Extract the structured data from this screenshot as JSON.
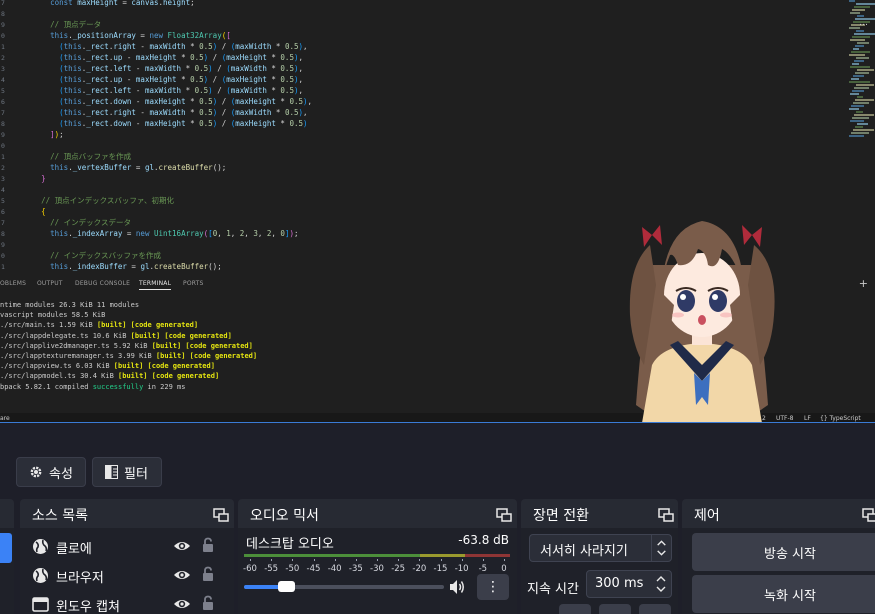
{
  "editor": {
    "line_numbers": [
      "7",
      "8",
      "9",
      "0",
      "1",
      "2",
      "3",
      "4",
      "5",
      "6",
      "7",
      "8",
      "9",
      "0",
      "1",
      "2",
      "3",
      "4",
      "5",
      "6",
      "7",
      "8",
      "9",
      "0",
      "1"
    ],
    "code": [
      [
        {
          "t": "        ",
          "c": "punc"
        },
        {
          "t": "const",
          "c": "kw"
        },
        {
          "t": " maxHeight",
          "c": "ident"
        },
        {
          "t": " = ",
          "c": "punc"
        },
        {
          "t": "canvas",
          "c": "ident"
        },
        {
          "t": ".",
          "c": "punc"
        },
        {
          "t": "height",
          "c": "ident"
        },
        {
          "t": ";",
          "c": "punc"
        }
      ],
      [],
      [
        {
          "t": "        ",
          "c": "punc"
        },
        {
          "t": "// 頂点データ",
          "c": "cm"
        }
      ],
      [
        {
          "t": "        ",
          "c": "punc"
        },
        {
          "t": "this",
          "c": "kw"
        },
        {
          "t": ".",
          "c": "punc"
        },
        {
          "t": "_positionArray",
          "c": "ident"
        },
        {
          "t": " = ",
          "c": "punc"
        },
        {
          "t": "new",
          "c": "kw"
        },
        {
          "t": " ",
          "c": "punc"
        },
        {
          "t": "Float32Array",
          "c": "cls"
        },
        {
          "t": "(",
          "c": "br1"
        },
        {
          "t": "[",
          "c": "br2"
        }
      ],
      [
        {
          "t": "          (",
          "c": "br3"
        },
        {
          "t": "this",
          "c": "kw"
        },
        {
          "t": ".",
          "c": "punc"
        },
        {
          "t": "_rect",
          "c": "ident"
        },
        {
          "t": ".",
          "c": "punc"
        },
        {
          "t": "right",
          "c": "ident"
        },
        {
          "t": " - ",
          "c": "punc"
        },
        {
          "t": "maxWidth",
          "c": "ident"
        },
        {
          "t": " * ",
          "c": "punc"
        },
        {
          "t": "0.5",
          "c": "num"
        },
        {
          "t": ")",
          "c": "br3"
        },
        {
          "t": " / ",
          "c": "punc"
        },
        {
          "t": "(",
          "c": "br3"
        },
        {
          "t": "maxWidth",
          "c": "ident"
        },
        {
          "t": " * ",
          "c": "punc"
        },
        {
          "t": "0.5",
          "c": "num"
        },
        {
          "t": ")",
          "c": "br3"
        },
        {
          "t": ",",
          "c": "punc"
        }
      ],
      [
        {
          "t": "          (",
          "c": "br3"
        },
        {
          "t": "this",
          "c": "kw"
        },
        {
          "t": ".",
          "c": "punc"
        },
        {
          "t": "_rect",
          "c": "ident"
        },
        {
          "t": ".",
          "c": "punc"
        },
        {
          "t": "up",
          "c": "ident"
        },
        {
          "t": " - ",
          "c": "punc"
        },
        {
          "t": "maxHeight",
          "c": "ident"
        },
        {
          "t": " * ",
          "c": "punc"
        },
        {
          "t": "0.5",
          "c": "num"
        },
        {
          "t": ")",
          "c": "br3"
        },
        {
          "t": " / ",
          "c": "punc"
        },
        {
          "t": "(",
          "c": "br3"
        },
        {
          "t": "maxHeight",
          "c": "ident"
        },
        {
          "t": " * ",
          "c": "punc"
        },
        {
          "t": "0.5",
          "c": "num"
        },
        {
          "t": ")",
          "c": "br3"
        },
        {
          "t": ",",
          "c": "punc"
        }
      ],
      [
        {
          "t": "          (",
          "c": "br3"
        },
        {
          "t": "this",
          "c": "kw"
        },
        {
          "t": ".",
          "c": "punc"
        },
        {
          "t": "_rect",
          "c": "ident"
        },
        {
          "t": ".",
          "c": "punc"
        },
        {
          "t": "left",
          "c": "ident"
        },
        {
          "t": " - ",
          "c": "punc"
        },
        {
          "t": "maxWidth",
          "c": "ident"
        },
        {
          "t": " * ",
          "c": "punc"
        },
        {
          "t": "0.5",
          "c": "num"
        },
        {
          "t": ")",
          "c": "br3"
        },
        {
          "t": " / ",
          "c": "punc"
        },
        {
          "t": "(",
          "c": "br3"
        },
        {
          "t": "maxWidth",
          "c": "ident"
        },
        {
          "t": " * ",
          "c": "punc"
        },
        {
          "t": "0.5",
          "c": "num"
        },
        {
          "t": ")",
          "c": "br3"
        },
        {
          "t": ",",
          "c": "punc"
        }
      ],
      [
        {
          "t": "          (",
          "c": "br3"
        },
        {
          "t": "this",
          "c": "kw"
        },
        {
          "t": ".",
          "c": "punc"
        },
        {
          "t": "_rect",
          "c": "ident"
        },
        {
          "t": ".",
          "c": "punc"
        },
        {
          "t": "up",
          "c": "ident"
        },
        {
          "t": " - ",
          "c": "punc"
        },
        {
          "t": "maxHeight",
          "c": "ident"
        },
        {
          "t": " * ",
          "c": "punc"
        },
        {
          "t": "0.5",
          "c": "num"
        },
        {
          "t": ")",
          "c": "br3"
        },
        {
          "t": " / ",
          "c": "punc"
        },
        {
          "t": "(",
          "c": "br3"
        },
        {
          "t": "maxHeight",
          "c": "ident"
        },
        {
          "t": " * ",
          "c": "punc"
        },
        {
          "t": "0.5",
          "c": "num"
        },
        {
          "t": ")",
          "c": "br3"
        },
        {
          "t": ",",
          "c": "punc"
        }
      ],
      [
        {
          "t": "          (",
          "c": "br3"
        },
        {
          "t": "this",
          "c": "kw"
        },
        {
          "t": ".",
          "c": "punc"
        },
        {
          "t": "_rect",
          "c": "ident"
        },
        {
          "t": ".",
          "c": "punc"
        },
        {
          "t": "left",
          "c": "ident"
        },
        {
          "t": " - ",
          "c": "punc"
        },
        {
          "t": "maxWidth",
          "c": "ident"
        },
        {
          "t": " * ",
          "c": "punc"
        },
        {
          "t": "0.5",
          "c": "num"
        },
        {
          "t": ")",
          "c": "br3"
        },
        {
          "t": " / ",
          "c": "punc"
        },
        {
          "t": "(",
          "c": "br3"
        },
        {
          "t": "maxWidth",
          "c": "ident"
        },
        {
          "t": " * ",
          "c": "punc"
        },
        {
          "t": "0.5",
          "c": "num"
        },
        {
          "t": ")",
          "c": "br3"
        },
        {
          "t": ",",
          "c": "punc"
        }
      ],
      [
        {
          "t": "          (",
          "c": "br3"
        },
        {
          "t": "this",
          "c": "kw"
        },
        {
          "t": ".",
          "c": "punc"
        },
        {
          "t": "_rect",
          "c": "ident"
        },
        {
          "t": ".",
          "c": "punc"
        },
        {
          "t": "down",
          "c": "ident"
        },
        {
          "t": " - ",
          "c": "punc"
        },
        {
          "t": "maxHeight",
          "c": "ident"
        },
        {
          "t": " * ",
          "c": "punc"
        },
        {
          "t": "0.5",
          "c": "num"
        },
        {
          "t": ")",
          "c": "br3"
        },
        {
          "t": " / ",
          "c": "punc"
        },
        {
          "t": "(",
          "c": "br3"
        },
        {
          "t": "maxHeight",
          "c": "ident"
        },
        {
          "t": " * ",
          "c": "punc"
        },
        {
          "t": "0.5",
          "c": "num"
        },
        {
          "t": ")",
          "c": "br3"
        },
        {
          "t": ",",
          "c": "punc"
        }
      ],
      [
        {
          "t": "          (",
          "c": "br3"
        },
        {
          "t": "this",
          "c": "kw"
        },
        {
          "t": ".",
          "c": "punc"
        },
        {
          "t": "_rect",
          "c": "ident"
        },
        {
          "t": ".",
          "c": "punc"
        },
        {
          "t": "right",
          "c": "ident"
        },
        {
          "t": " - ",
          "c": "punc"
        },
        {
          "t": "maxWidth",
          "c": "ident"
        },
        {
          "t": " * ",
          "c": "punc"
        },
        {
          "t": "0.5",
          "c": "num"
        },
        {
          "t": ")",
          "c": "br3"
        },
        {
          "t": " / ",
          "c": "punc"
        },
        {
          "t": "(",
          "c": "br3"
        },
        {
          "t": "maxWidth",
          "c": "ident"
        },
        {
          "t": " * ",
          "c": "punc"
        },
        {
          "t": "0.5",
          "c": "num"
        },
        {
          "t": ")",
          "c": "br3"
        },
        {
          "t": ",",
          "c": "punc"
        }
      ],
      [
        {
          "t": "          (",
          "c": "br3"
        },
        {
          "t": "this",
          "c": "kw"
        },
        {
          "t": ".",
          "c": "punc"
        },
        {
          "t": "_rect",
          "c": "ident"
        },
        {
          "t": ".",
          "c": "punc"
        },
        {
          "t": "down",
          "c": "ident"
        },
        {
          "t": " - ",
          "c": "punc"
        },
        {
          "t": "maxHeight",
          "c": "ident"
        },
        {
          "t": " * ",
          "c": "punc"
        },
        {
          "t": "0.5",
          "c": "num"
        },
        {
          "t": ")",
          "c": "br3"
        },
        {
          "t": " / ",
          "c": "punc"
        },
        {
          "t": "(",
          "c": "br3"
        },
        {
          "t": "maxHeight",
          "c": "ident"
        },
        {
          "t": " * ",
          "c": "punc"
        },
        {
          "t": "0.5",
          "c": "num"
        },
        {
          "t": ")",
          "c": "br3"
        }
      ],
      [
        {
          "t": "        ",
          "c": "punc"
        },
        {
          "t": "]",
          "c": "br2"
        },
        {
          "t": ")",
          "c": "br1"
        },
        {
          "t": ";",
          "c": "punc"
        }
      ],
      [],
      [
        {
          "t": "        ",
          "c": "punc"
        },
        {
          "t": "// 頂点バッファを作成",
          "c": "cm"
        }
      ],
      [
        {
          "t": "        ",
          "c": "punc"
        },
        {
          "t": "this",
          "c": "kw"
        },
        {
          "t": ".",
          "c": "punc"
        },
        {
          "t": "_vertexBuffer",
          "c": "ident"
        },
        {
          "t": " = ",
          "c": "punc"
        },
        {
          "t": "gl",
          "c": "ident"
        },
        {
          "t": ".",
          "c": "punc"
        },
        {
          "t": "createBuffer",
          "c": "fn"
        },
        {
          "t": "();",
          "c": "punc"
        }
      ],
      [
        {
          "t": "      ",
          "c": "punc"
        },
        {
          "t": "}",
          "c": "br2"
        }
      ],
      [],
      [
        {
          "t": "      ",
          "c": "punc"
        },
        {
          "t": "// 頂点インデックスバッファ、初期化",
          "c": "cm"
        }
      ],
      [
        {
          "t": "      ",
          "c": "punc"
        },
        {
          "t": "{",
          "c": "br1"
        }
      ],
      [
        {
          "t": "        ",
          "c": "punc"
        },
        {
          "t": "// インデックスデータ",
          "c": "cm"
        }
      ],
      [
        {
          "t": "        ",
          "c": "punc"
        },
        {
          "t": "this",
          "c": "kw"
        },
        {
          "t": ".",
          "c": "punc"
        },
        {
          "t": "_indexArray",
          "c": "ident"
        },
        {
          "t": " = ",
          "c": "punc"
        },
        {
          "t": "new",
          "c": "kw"
        },
        {
          "t": " ",
          "c": "punc"
        },
        {
          "t": "Uint16Array",
          "c": "cls"
        },
        {
          "t": "(",
          "c": "br2"
        },
        {
          "t": "[",
          "c": "br3"
        },
        {
          "t": "0",
          "c": "num"
        },
        {
          "t": ", ",
          "c": "punc"
        },
        {
          "t": "1",
          "c": "num"
        },
        {
          "t": ", ",
          "c": "punc"
        },
        {
          "t": "2",
          "c": "num"
        },
        {
          "t": ", ",
          "c": "punc"
        },
        {
          "t": "3",
          "c": "num"
        },
        {
          "t": ", ",
          "c": "punc"
        },
        {
          "t": "2",
          "c": "num"
        },
        {
          "t": ", ",
          "c": "punc"
        },
        {
          "t": "0",
          "c": "num"
        },
        {
          "t": "]",
          "c": "br3"
        },
        {
          "t": ")",
          "c": "br2"
        },
        {
          "t": ";",
          "c": "punc"
        }
      ],
      [],
      [
        {
          "t": "        ",
          "c": "punc"
        },
        {
          "t": "// インデックスバッファを作成",
          "c": "cm"
        }
      ],
      [
        {
          "t": "        ",
          "c": "punc"
        },
        {
          "t": "this",
          "c": "kw"
        },
        {
          "t": ".",
          "c": "punc"
        },
        {
          "t": "_indexBuffer",
          "c": "ident"
        },
        {
          "t": " = ",
          "c": "punc"
        },
        {
          "t": "gl",
          "c": "ident"
        },
        {
          "t": ".",
          "c": "punc"
        },
        {
          "t": "createBuffer",
          "c": "fn"
        },
        {
          "t": "();",
          "c": "punc"
        }
      ]
    ]
  },
  "panel": {
    "tabs": [
      "OBLEMS",
      "OUTPUT",
      "DEBUG CONSOLE",
      "TERMINAL",
      "PORTS"
    ],
    "active_tab": "TERMINAL",
    "add_label": "+",
    "more_label": "…"
  },
  "terminal": {
    "lines": [
      [
        {
          "t": "ntime modules 26.3 KiB 11 modules",
          "c": "plain"
        }
      ],
      [
        {
          "t": "vascript modules 58.5 KiB",
          "c": "plain"
        }
      ],
      [
        {
          "t": "./src/main.ts 1.59 KiB ",
          "c": "plain"
        },
        {
          "t": "[built] [code generated]",
          "c": "yellow"
        }
      ],
      [
        {
          "t": "./src/lappdelegate.ts 10.6 KiB ",
          "c": "plain"
        },
        {
          "t": "[built] [code generated]",
          "c": "yellow"
        }
      ],
      [
        {
          "t": "./src/lapplive2dmanager.ts 5.92 KiB ",
          "c": "plain"
        },
        {
          "t": "[built] [code generated]",
          "c": "yellow"
        }
      ],
      [
        {
          "t": "./src/lapptexturemanager.ts 3.99 KiB ",
          "c": "plain"
        },
        {
          "t": "[built] [code generated]",
          "c": "yellow"
        }
      ],
      [
        {
          "t": "./src/lappview.ts 6.03 KiB ",
          "c": "plain"
        },
        {
          "t": "[built] [code generated]",
          "c": "yellow"
        }
      ],
      [
        {
          "t": "./src/lappmodel.ts 30.4 KiB ",
          "c": "plain"
        },
        {
          "t": "[built] [code generated]",
          "c": "yellow"
        }
      ],
      [
        {
          "t": "bpack 5.82.1 compiled ",
          "c": "plain"
        },
        {
          "t": "successfully",
          "c": "green"
        },
        {
          "t": " in 229 ms",
          "c": "plain"
        }
      ]
    ]
  },
  "statusbar": {
    "left": "are",
    "line": "2",
    "encoding": "UTF-8",
    "eol": "LF",
    "language": "{} TypeScript"
  },
  "obs": {
    "properties_label": "속성",
    "filters_label": "필터",
    "sources": {
      "title": "소스 목록",
      "items": [
        {
          "label": "클로에",
          "icon": "globe-icon"
        },
        {
          "label": "브라우저",
          "icon": "globe-icon"
        },
        {
          "label": "윈도우 캡쳐",
          "icon": "window-icon"
        }
      ]
    },
    "mixer": {
      "title": "오디오 믹서",
      "channel_name": "데스크탑 오디오",
      "level_db": "-63.8 dB",
      "scale": [
        "-60",
        "-55",
        "-50",
        "-45",
        "-40",
        "-35",
        "-30",
        "-25",
        "-20",
        "-15",
        "-10",
        "-5",
        "0"
      ],
      "volume_fraction": 0.17,
      "menu_label": "⋮"
    },
    "transitions": {
      "title": "장면 전환",
      "selected": "서서히 사라지기",
      "duration_label": "지속 시간",
      "duration_value": "300 ms"
    },
    "controls": {
      "title": "제어",
      "start_streaming": "방송 시작",
      "start_recording": "녹화 시작"
    },
    "colors": {
      "accent": "#3b82f6",
      "meter_green": "#4c8f3a",
      "meter_yellow": "#9a9a2e",
      "meter_red": "#8e3535"
    }
  }
}
